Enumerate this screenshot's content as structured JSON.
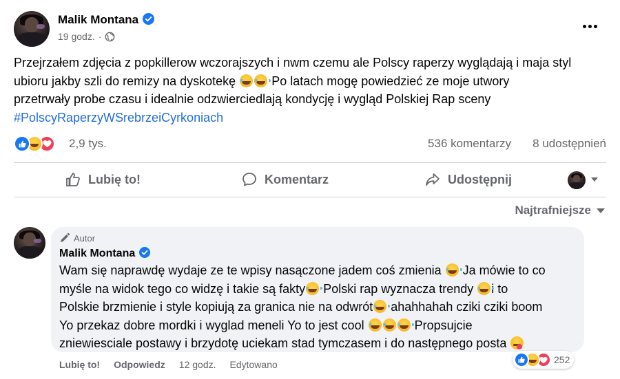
{
  "post": {
    "author": "Malik Montana",
    "time": "19 godz.",
    "separator": "·",
    "text_lines": [
      "Przejrzałem zdjęcia z popkillerow wczorajszych i nwm czemu ale Polscy raperzy wyglądają i maja styl",
      "ubioru jakby szli do remizy na dyskotekę",
      "Po latach mogę powiedzieć ze moje utwory",
      "przetrwały probe czasu i idealnie odzwierciedlają kondycję i wygląd Polskiej Rap sceny"
    ],
    "hashtag": "#PolscyRaperzyWSrebrzeiCyrkoniach"
  },
  "stats": {
    "reactions": "2,9 tys.",
    "comments": "536 komentarzy",
    "shares": "8 udostępnień"
  },
  "actions": {
    "like": "Lubię to!",
    "comment": "Komentarz",
    "share": "Udostępnij"
  },
  "sort": {
    "label": "Najtrafniejsze"
  },
  "comment": {
    "badge": "Autor",
    "author": "Malik Montana",
    "lines": [
      "Wam się naprawdę wydaje ze te wpisy nasączone jadem coś zmienia",
      "Ja mówie to co",
      "myśle na widok tego co widzę i takie są fakty",
      "Polski rap wyznacza trendy",
      "i to",
      "Polskie brzmienie i style kopiują za granica nie na odwrót",
      "ahahhahah cziki cziki boom",
      "Yo przekaz dobre mordki i wyglad meneli Yo to jest cool",
      "Propsujcie",
      "zniewiesciale postawy i brzydotę uciekam stad tymczasem i do następnego posta"
    ],
    "like": "Lubię to!",
    "reply": "Odpowiedz",
    "time": "12 godz.",
    "edited": "Edytowano",
    "reaction_count": "252"
  },
  "icons": {
    "verified": "verified-badge-icon",
    "globe": "globe-icon",
    "more": "more-options-icon",
    "like": "thumbs-up-icon",
    "comment": "speech-bubble-icon",
    "share": "share-arrow-icon",
    "pencil": "pencil-icon"
  },
  "colors": {
    "accent_blue": "#1877f2",
    "hashtag_blue": "#216fdb",
    "secondary_text": "#65676b",
    "bubble_bg": "#f0f2f5",
    "love_red": "#f33e58",
    "haha_yellow": "#f7b928"
  }
}
